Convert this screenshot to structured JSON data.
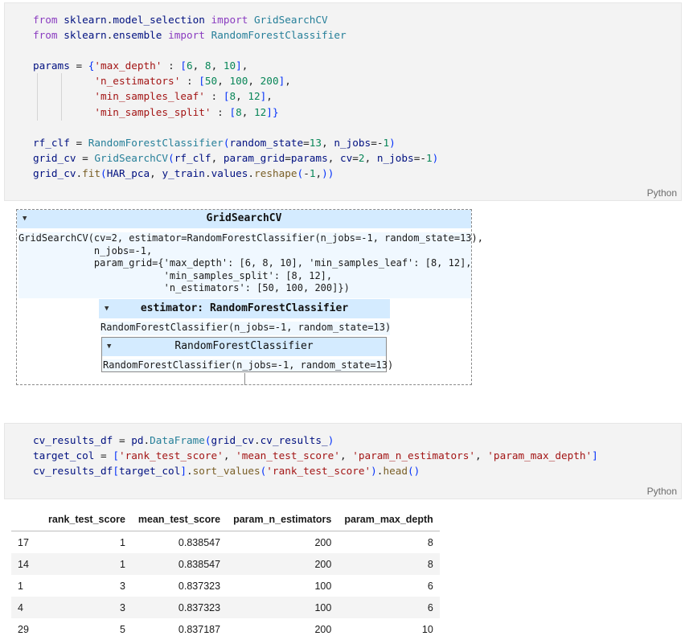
{
  "cell1": {
    "language": "Python",
    "code": [
      "from sklearn.model_selection import GridSearchCV",
      "from sklearn.ensemble import RandomForestClassifier",
      "",
      "params = {'max_depth' : [6, 8, 10],",
      "          'n_estimators' : [50, 100, 200],",
      "          'min_samples_leaf' : [8, 12],",
      "          'min_samples_split' : [8, 12]}",
      "",
      "rf_clf = RandomForestClassifier(random_state=13, n_jobs=-1)",
      "grid_cv = GridSearchCV(rf_clf, param_grid=params, cv=2, n_jobs=-1)",
      "grid_cv.fit(HAR_pca, y_train.values.reshape(-1,))"
    ]
  },
  "output1": {
    "outer_title": "GridSearchCV",
    "outer_repr": "GridSearchCV(cv=2, estimator=RandomForestClassifier(n_jobs=-1, random_state=13),\n             n_jobs=-1,\n             param_grid={'max_depth': [6, 8, 10], 'min_samples_leaf': [8, 12],\n                         'min_samples_split': [8, 12],\n                         'n_estimators': [50, 100, 200]})",
    "estimator_title": "estimator: RandomForestClassifier",
    "estimator_repr": "RandomForestClassifier(n_jobs=-1, random_state=13)",
    "inner_title": "RandomForestClassifier",
    "inner_repr": "RandomForestClassifier(n_jobs=-1, random_state=13)"
  },
  "cell2": {
    "language": "Python",
    "code": [
      "cv_results_df = pd.DataFrame(grid_cv.cv_results_)",
      "target_col = ['rank_test_score', 'mean_test_score', 'param_n_estimators', 'param_max_depth']",
      "cv_results_df[target_col].sort_values('rank_test_score').head()"
    ]
  },
  "table": {
    "columns": [
      "",
      "rank_test_score",
      "mean_test_score",
      "param_n_estimators",
      "param_max_depth"
    ],
    "rows": [
      [
        "17",
        "1",
        "0.838547",
        "200",
        "8"
      ],
      [
        "14",
        "1",
        "0.838547",
        "200",
        "8"
      ],
      [
        "1",
        "3",
        "0.837323",
        "100",
        "6"
      ],
      [
        "4",
        "3",
        "0.837323",
        "100",
        "6"
      ],
      [
        "29",
        "5",
        "0.837187",
        "200",
        "10"
      ]
    ]
  },
  "colors": {
    "keyword": "#8a3cc0",
    "string": "#a31515",
    "number": "#098658",
    "class": "#267f99",
    "function": "#795e26",
    "widget_header": "#d4ebff"
  }
}
